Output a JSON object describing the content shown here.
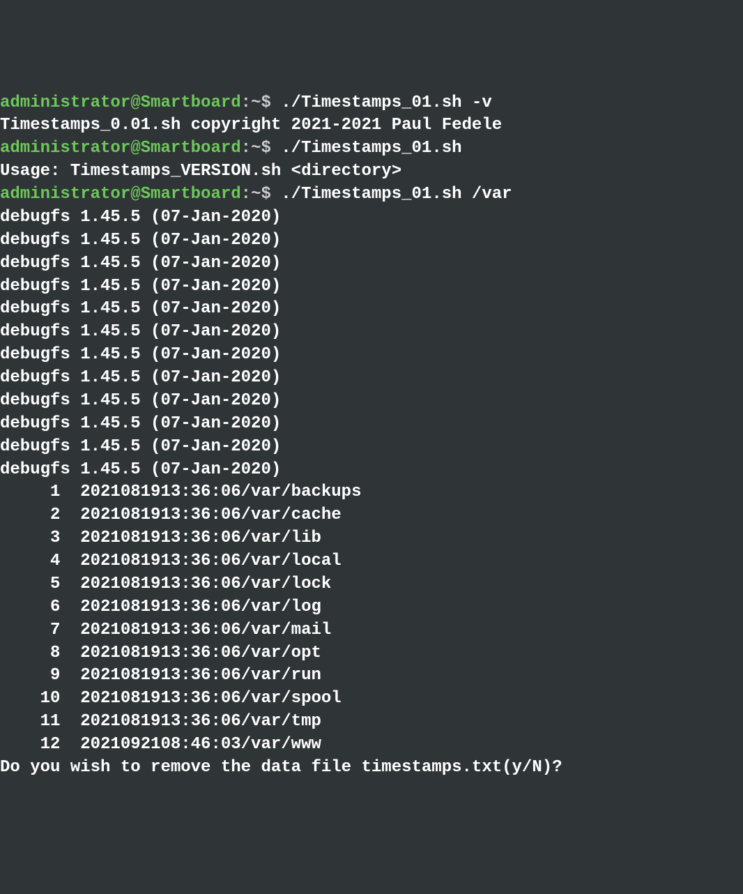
{
  "prompt": {
    "userhost": "administrator@Smartboard",
    "sep": ":",
    "path": "~",
    "dollar": "$"
  },
  "cmds": {
    "c1": "./Timestamps_01.sh -v",
    "c2": "./Timestamps_01.sh",
    "c3": "./Timestamps_01.sh /var"
  },
  "out": {
    "version": "Timestamps_0.01.sh copyright 2021-2021 Paul Fedele",
    "usage": "Usage: Timestamps_VERSION.sh <directory>",
    "debugfs": "debugfs 1.45.5 (07-Jan-2020)",
    "prompt_remove": "Do you wish to remove the data file timestamps.txt(y/N)?"
  },
  "rows": [
    {
      "n": "1",
      "t": "2021081913:36:06/var/backups"
    },
    {
      "n": "2",
      "t": "2021081913:36:06/var/cache"
    },
    {
      "n": "3",
      "t": "2021081913:36:06/var/lib"
    },
    {
      "n": "4",
      "t": "2021081913:36:06/var/local"
    },
    {
      "n": "5",
      "t": "2021081913:36:06/var/lock"
    },
    {
      "n": "6",
      "t": "2021081913:36:06/var/log"
    },
    {
      "n": "7",
      "t": "2021081913:36:06/var/mail"
    },
    {
      "n": "8",
      "t": "2021081913:36:06/var/opt"
    },
    {
      "n": "9",
      "t": "2021081913:36:06/var/run"
    },
    {
      "n": "10",
      "t": "2021081913:36:06/var/spool"
    },
    {
      "n": "11",
      "t": "2021081913:36:06/var/tmp"
    },
    {
      "n": "12",
      "t": "2021092108:46:03/var/www"
    }
  ]
}
